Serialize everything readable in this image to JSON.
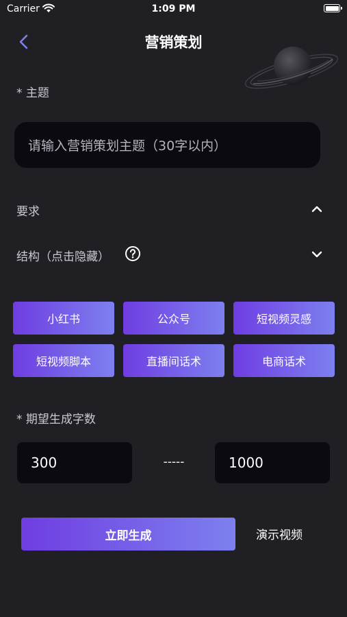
{
  "status_bar": {
    "carrier": "Carrier",
    "time": "1:09 PM",
    "icons": [
      "wifi-icon",
      "battery-icon"
    ]
  },
  "nav": {
    "title": "营销策划",
    "back_icon": "chevron-left-icon",
    "decoration": "planet-ring-icon"
  },
  "topic": {
    "label": "* 主题",
    "placeholder": "请输入营销策划主题（30字以内）"
  },
  "requirement": {
    "label": "要求",
    "icon": "chevron-up-icon"
  },
  "structure": {
    "label": "结构（点击隐藏）",
    "help_icon": "question-circle-icon",
    "icon": "chevron-down-icon"
  },
  "chips": [
    {
      "label": "小红书"
    },
    {
      "label": "公众号"
    },
    {
      "label": "短视频灵感"
    },
    {
      "label": "短视频脚本"
    },
    {
      "label": "直播间话术"
    },
    {
      "label": "电商话术"
    }
  ],
  "word_count": {
    "label": "* 期望生成字数",
    "min": "300",
    "separator": "-----",
    "max": "1000"
  },
  "actions": {
    "generate_label": "立即生成",
    "demo_label": "演示视频"
  },
  "colors": {
    "background": "#1f1f24",
    "input_bg": "#0a0a10",
    "accent_start": "#6f3de1",
    "accent_end": "#7d80ef",
    "back_arrow": "#7d80ef"
  }
}
